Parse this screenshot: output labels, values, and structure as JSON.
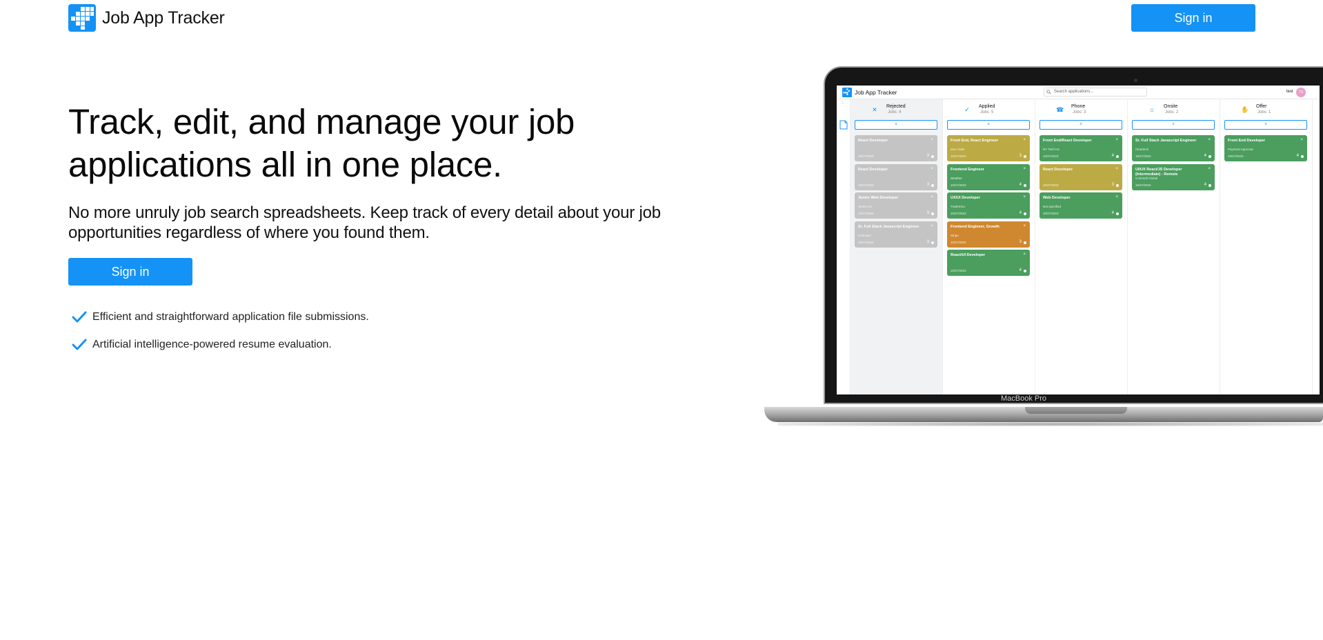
{
  "header": {
    "app_title": "Job App Tracker",
    "signin_label": "Sign in"
  },
  "hero": {
    "title": "Track, edit, and manage your job applications all in one place.",
    "subtitle": "No more unruly job search spreadsheets. Keep track of every detail about your job opportunities regardless of where you found them.",
    "signin_label": "Sign in",
    "features": [
      "Efficient and straightforward application file submissions.",
      "Artificial intelligence-powered resume evaluation."
    ]
  },
  "laptop": {
    "brand_label": "MacBook Pro",
    "app": {
      "title": "Job App Tracker",
      "search_placeholder": "Search applications...",
      "user_name": "test",
      "avatar_initials": "TS",
      "add_label": "+",
      "columns": [
        {
          "name": "Rejected",
          "count": "Jobs: 4",
          "icon": "close-icon",
          "icon_glyph": "✕",
          "icon_color": "#1492f5",
          "cards": [
            {
              "title": "React Developer",
              "company": "",
              "date": "10/27/2023",
              "num": "3",
              "color": "grey"
            },
            {
              "title": "React Developer",
              "company": "",
              "date": "10/27/2023",
              "num": "3",
              "color": "grey"
            },
            {
              "title": "Junior Web Developer",
              "company": "Vertex Inc",
              "date": "10/27/2023",
              "num": "3",
              "color": "grey"
            },
            {
              "title": "Sr. Full Stack Javascript Engineer",
              "company": "Unknown",
              "date": "10/27/2023",
              "num": "3",
              "color": "grey"
            }
          ]
        },
        {
          "name": "Applied",
          "count": "Jobs: 5",
          "icon": "check-icon",
          "icon_glyph": "✓",
          "icon_color": "#1492f5",
          "cards": [
            {
              "title": "Front End, React Engineer",
              "company": "Surv Gate",
              "date": "10/27/2023",
              "num": "3",
              "color": "olive"
            },
            {
              "title": "Frontend Engineer",
              "company": "Weather",
              "date": "10/27/2023",
              "num": "4",
              "color": "green"
            },
            {
              "title": "UX/UI Developer",
              "company": "TradeSmu",
              "date": "10/27/2023",
              "num": "4",
              "color": "green"
            },
            {
              "title": "Frontend Engineer, Growth",
              "company": "Stripe",
              "date": "10/27/2023",
              "num": "3",
              "color": "orange"
            },
            {
              "title": "React/UI Developer",
              "company": "",
              "date": "10/27/2023",
              "num": "4",
              "color": "green"
            }
          ]
        },
        {
          "name": "Phone",
          "count": "Jobs: 3",
          "icon": "phone-icon",
          "icon_glyph": "☎",
          "icon_color": "#1492f5",
          "cards": [
            {
              "title": "Front End/React Developer",
              "company": "NY Tech Inc",
              "date": "10/27/2023",
              "num": "4",
              "color": "green"
            },
            {
              "title": "React Developer",
              "company": "",
              "date": "10/27/2023",
              "num": "3",
              "color": "olive"
            },
            {
              "title": "Web Developer",
              "company": "Not specified",
              "date": "10/27/2023",
              "num": "4",
              "color": "green"
            }
          ]
        },
        {
          "name": "Onsite",
          "count": "Jobs: 2",
          "icon": "home-icon",
          "icon_glyph": "⌂",
          "icon_color": "#1492f5",
          "cards": [
            {
              "title": "Sr. Full Stack Javascript Engineer",
              "company": "Cleartech",
              "date": "10/27/2023",
              "num": "4",
              "color": "green"
            },
            {
              "title": "UI/UX React/JS Developer (Intermediate) - Remote",
              "company": "Cohesoft Global",
              "date": "10/27/2023",
              "num": "4",
              "color": "green"
            }
          ]
        },
        {
          "name": "Offer",
          "count": "Jobs: 1",
          "icon": "hand-icon",
          "icon_glyph": "✋",
          "icon_color": "#1492f5",
          "cards": [
            {
              "title": "Front End Developer",
              "company": "Payment Approval",
              "date": "10/27/2023",
              "num": "4",
              "color": "green"
            }
          ]
        }
      ]
    }
  },
  "colors": {
    "accent": "#1492f5",
    "card_green": "#4b9e5e",
    "card_olive": "#bcaa45",
    "card_orange": "#cf8830",
    "card_grey": "#c4c4c4"
  }
}
